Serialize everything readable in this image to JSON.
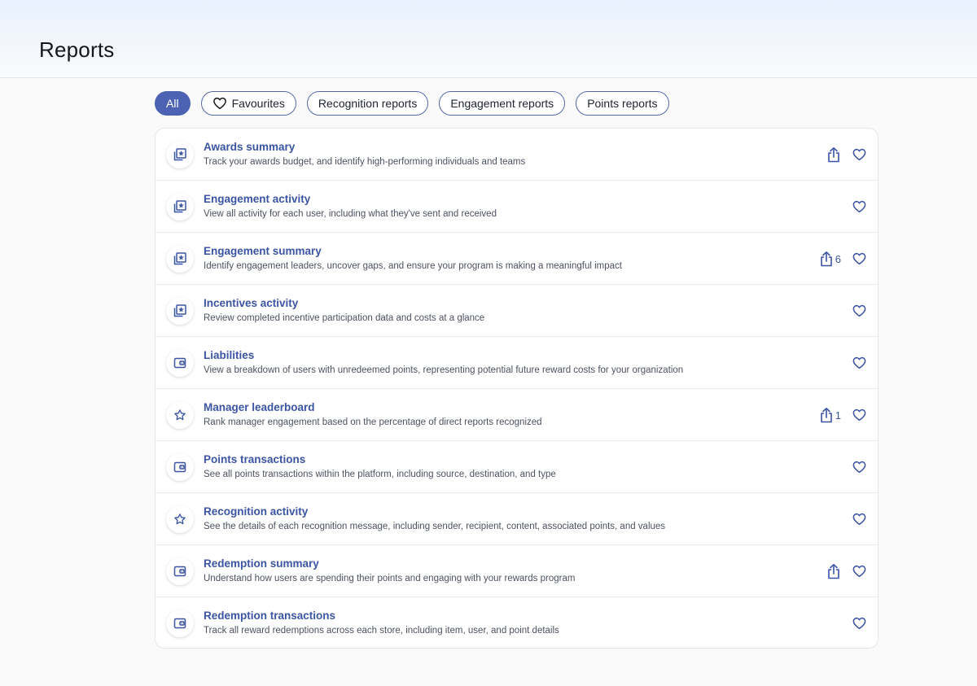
{
  "page": {
    "title": "Reports"
  },
  "filters": [
    {
      "label": "All",
      "active": true
    },
    {
      "label": "Favourites",
      "icon": "heart-icon"
    },
    {
      "label": "Recognition reports"
    },
    {
      "label": "Engagement reports"
    },
    {
      "label": "Points reports"
    }
  ],
  "colors": {
    "accent": "#4c63b3",
    "link": "#3b54a3",
    "text": "#1f2330",
    "muted": "#4b5160"
  },
  "reports": [
    {
      "title": "Awards summary",
      "description": "Track your awards budget, and identify high-performing individuals and teams",
      "icon": "award-card-icon",
      "share": true,
      "share_count": ""
    },
    {
      "title": "Engagement activity",
      "description": "View all activity for each user, including what they've sent and received",
      "icon": "award-card-icon",
      "share": false,
      "share_count": ""
    },
    {
      "title": "Engagement summary",
      "description": "Identify engagement leaders, uncover gaps, and ensure your program is making a meaningful impact",
      "icon": "award-card-icon",
      "share": true,
      "share_count": "6"
    },
    {
      "title": "Incentives activity",
      "description": "Review completed incentive participation data and costs at a glance",
      "icon": "award-card-icon",
      "share": false,
      "share_count": ""
    },
    {
      "title": "Liabilities",
      "description": "View a breakdown of users with unredeemed points, representing potential future reward costs for your organization",
      "icon": "wallet-icon",
      "share": false,
      "share_count": ""
    },
    {
      "title": "Manager leaderboard",
      "description": "Rank manager engagement based on the percentage of direct reports recognized",
      "icon": "star-icon",
      "share": true,
      "share_count": "1"
    },
    {
      "title": "Points transactions",
      "description": "See all points transactions within the platform, including source, destination, and type",
      "icon": "wallet-icon",
      "share": false,
      "share_count": ""
    },
    {
      "title": "Recognition activity",
      "description": "See the details of each recognition message, including sender, recipient, content, associated points, and values",
      "icon": "star-icon",
      "share": false,
      "share_count": ""
    },
    {
      "title": "Redemption summary",
      "description": "Understand how users are spending their points and engaging with your rewards program",
      "icon": "wallet-icon",
      "share": true,
      "share_count": ""
    },
    {
      "title": "Redemption transactions",
      "description": "Track all reward redemptions across each store, including item, user, and point details",
      "icon": "wallet-icon",
      "share": false,
      "share_count": ""
    }
  ]
}
